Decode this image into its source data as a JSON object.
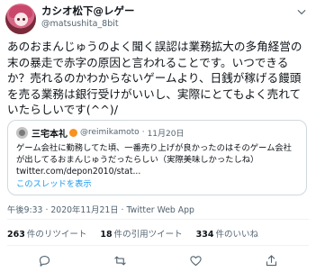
{
  "user": {
    "display_name": "カシオ松下@レゲー",
    "handle": "@matsushita_8bit"
  },
  "tweet": {
    "text": "あのおまんじゅうのよく聞く誤認は業務拡大の多角経営の末の暴走で赤字の原因と言われることです。いつできるか？売れるのかわからないゲームより、日銭が稼げる饅頭を売る業務は銀行受けがいいし、実際にとてもよく売れていたらしいです(^^)/"
  },
  "quote": {
    "name": "三宅本礼",
    "handle": "@reimikamoto",
    "separator": "·",
    "date": "11月20日",
    "text": "ゲーム会社に勤務してた頃、一番売り上げが良かったのはそのゲーム会社が出してるおまんじゅうだったらしい（実際美味しかったしね）",
    "link": "twitter.com/depon2010/stat...",
    "thread_label": "このスレッドを表示"
  },
  "meta": {
    "time": "午後9:33",
    "sep1": " · ",
    "date": "2020年11月21日",
    "sep2": " · ",
    "client": "Twitter Web App"
  },
  "stats": {
    "retweets_count": "263",
    "retweets_label": "件のリツイート",
    "quotes_count": "18",
    "quotes_label": "件の引用ツイート",
    "likes_count": "334",
    "likes_label": "件のいいね"
  },
  "icons": {
    "menu": "chevron-down-icon",
    "reply": "reply-icon",
    "retweet": "retweet-icon",
    "like": "heart-icon",
    "share": "share-icon"
  },
  "colors": {
    "link": "#1d9bf0",
    "secondary": "#536471",
    "text": "#0f1419"
  }
}
